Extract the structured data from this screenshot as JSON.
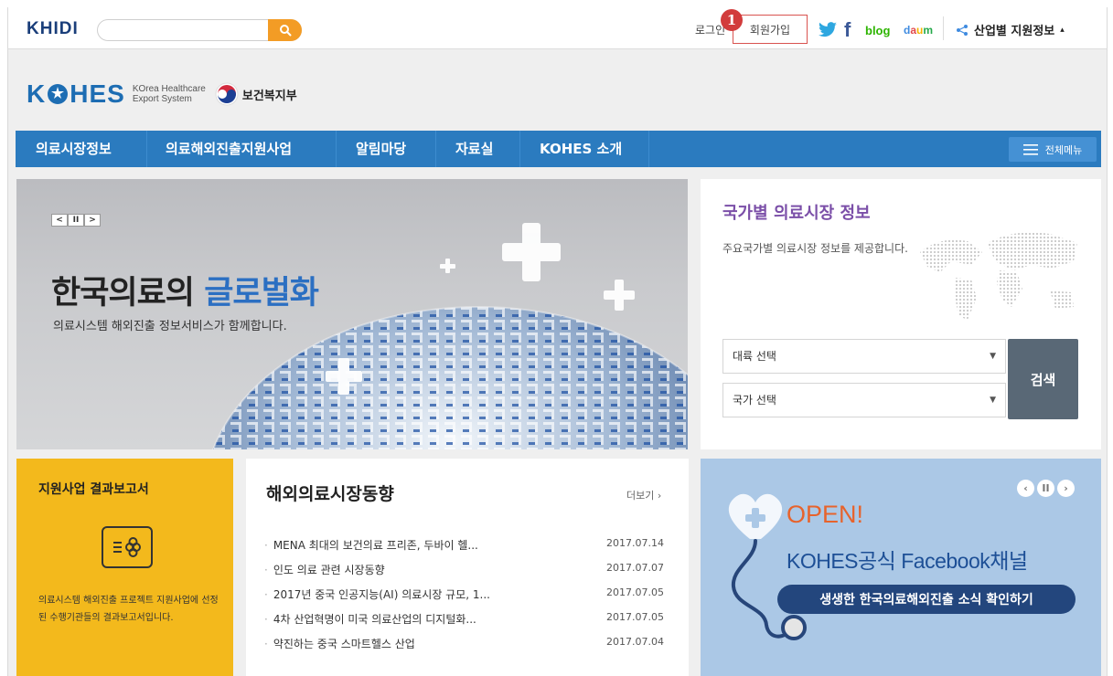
{
  "util": {
    "logo": "KHIDI",
    "search_placeholder": "",
    "login": "로그인",
    "join": "회원가입",
    "step_badge": "1",
    "sns": {
      "facebook": "f",
      "blog": "blog",
      "daum": "daum"
    },
    "industry_info": "산업별 지원정보",
    "industry_arrow": "▴"
  },
  "brand": {
    "kohes_pre": "K",
    "kohes_post": "HES",
    "kohes_sub_line1": "KOrea Healthcare",
    "kohes_sub_line2": "Export System",
    "ministry": "보건복지부"
  },
  "nav": {
    "items": [
      "의료시장정보",
      "의료해외진출지원사업",
      "알림마당",
      "자료실",
      "KOHES 소개"
    ],
    "all_menu": "전체메뉴"
  },
  "hero": {
    "ctrl_prev": "<",
    "ctrl_pause": "II",
    "ctrl_next": ">",
    "title_pre": "한국의료의 ",
    "title_accent": "글로벌화",
    "subtitle": "의료시스템 해외진출 정보서비스가 함께합니다."
  },
  "country": {
    "title": "국가별 의료시장 정보",
    "desc": "주요국가별 의료시장 정보를 제공합니다.",
    "select1": "대륙 선택",
    "select2": "국가 선택",
    "search": "검색"
  },
  "report": {
    "title": "지원사업 결과보고서",
    "desc": "의료시스템 해외진출 프로젝트 지원사업에 선정된 수행기관들의 결과보고서입니다."
  },
  "news": {
    "title": "해외의료시장동향",
    "more": "더보기",
    "more_arrow": "›",
    "items": [
      {
        "title": "MENA 최대의 보건의료 프리존, 두바이 헬...",
        "date": "2017.07.14"
      },
      {
        "title": "인도 의료 관련 시장동향",
        "date": "2017.07.07"
      },
      {
        "title": "2017년 중국 인공지능(AI) 의료시장 규모, 1...",
        "date": "2017.07.05"
      },
      {
        "title": "4차 산업혁명이 미국 의료산업의 디지털화...",
        "date": "2017.07.05"
      },
      {
        "title": "약진하는 중국 스마트헬스 산업",
        "date": "2017.07.04"
      }
    ]
  },
  "promo": {
    "ctrl_prev": "‹",
    "ctrl_pause": "II",
    "ctrl_next": "›",
    "open": "OPEN!",
    "headline": "KOHES공식 Facebook채널",
    "pill": "생생한 한국의료해외진출 소식 확인하기"
  },
  "colors": {
    "nav_blue": "#2b7bbf",
    "accent_orange": "#f39c25",
    "report_yellow": "#f3b91c",
    "promo_blue": "#abc8e6",
    "badge_red": "#d23c3c"
  }
}
